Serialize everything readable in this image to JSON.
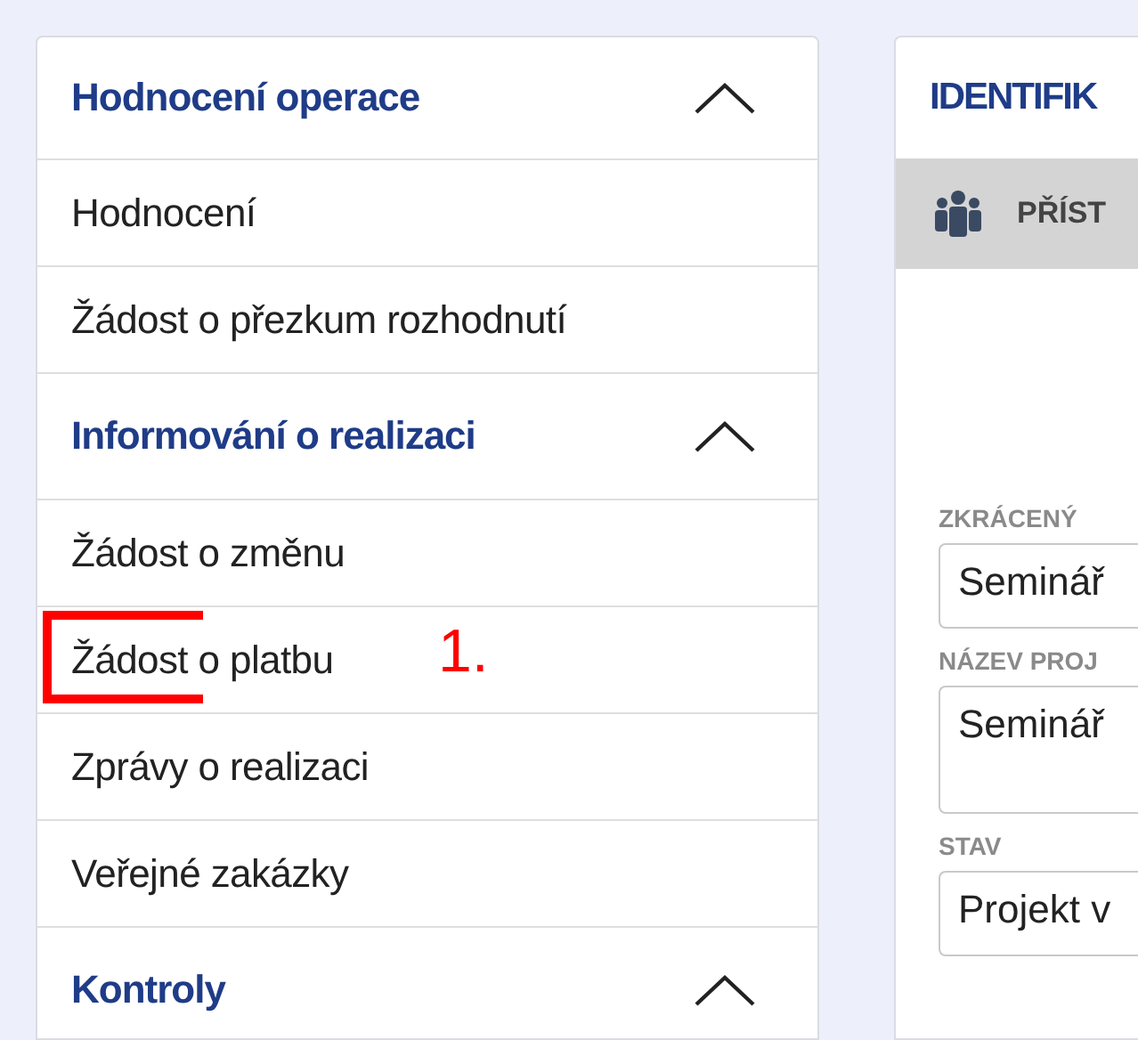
{
  "menu": [
    {
      "kind": "section",
      "label": "Hodnocení operace",
      "expanded": true
    },
    {
      "kind": "item",
      "label": "Hodnocení",
      "marked": false
    },
    {
      "kind": "item",
      "label": "Žádost o přezkum rozhodnutí",
      "marked": false
    },
    {
      "kind": "section",
      "label": "Informování o realizaci",
      "expanded": true
    },
    {
      "kind": "item",
      "label": "Žádost o změnu",
      "marked": false
    },
    {
      "kind": "item",
      "label": "Žádost o platbu",
      "marked": true
    },
    {
      "kind": "item",
      "label": "Zprávy o realizaci",
      "marked": false
    },
    {
      "kind": "item",
      "label": "Veřejné zakázky",
      "marked": false
    },
    {
      "kind": "section",
      "label": "Kontroly",
      "expanded": true
    }
  ],
  "annotation": "1.",
  "detail": {
    "title": "IDENTIFIK",
    "tab": "PŘÍST",
    "fields": [
      {
        "kind": "input",
        "label": "ZKRÁCENÝ",
        "value": "Seminář"
      },
      {
        "kind": "textarea",
        "label": "NÁZEV PROJ",
        "value": "Seminář"
      },
      {
        "kind": "input",
        "label": "STAV",
        "value": "Projekt v"
      }
    ]
  }
}
